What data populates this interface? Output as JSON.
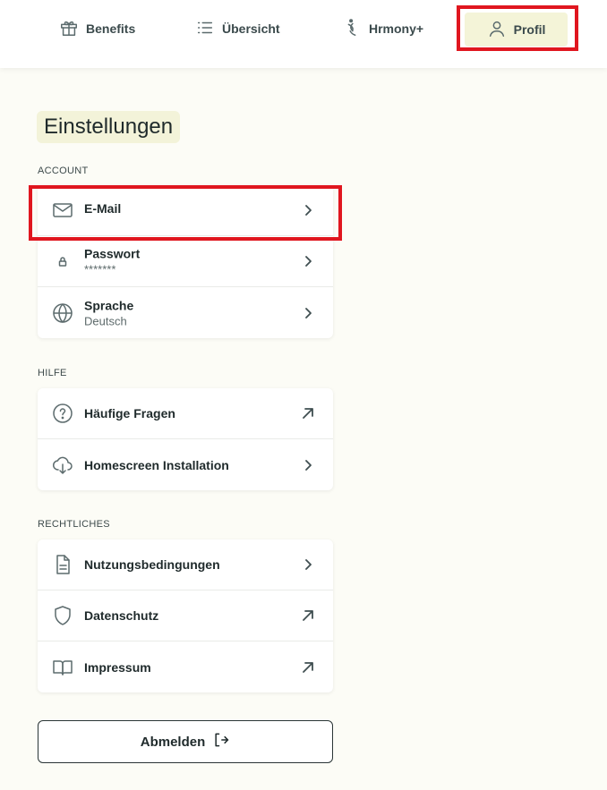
{
  "nav": {
    "benefits": "Benefits",
    "uebersicht": "Übersicht",
    "hrmony": "Hrmony+",
    "profil": "Profil"
  },
  "page": {
    "title": "Einstellungen"
  },
  "sections": {
    "account": {
      "label": "ACCOUNT",
      "email": {
        "title": "E-Mail"
      },
      "password": {
        "title": "Passwort",
        "value": "*******"
      },
      "language": {
        "title": "Sprache",
        "value": "Deutsch"
      }
    },
    "help": {
      "label": "HILFE",
      "faq": {
        "title": "Häufige Fragen"
      },
      "homescreen": {
        "title": "Homescreen Installation"
      }
    },
    "legal": {
      "label": "RECHTLICHES",
      "terms": {
        "title": "Nutzungsbedingungen"
      },
      "privacy": {
        "title": "Datenschutz"
      },
      "imprint": {
        "title": "Impressum"
      }
    }
  },
  "logout": {
    "label": "Abmelden"
  },
  "colors": {
    "background": "#fcfcf6",
    "active_tab": "#f4f4d8",
    "highlight": "#e0161f",
    "text": "#1f2a2b"
  }
}
